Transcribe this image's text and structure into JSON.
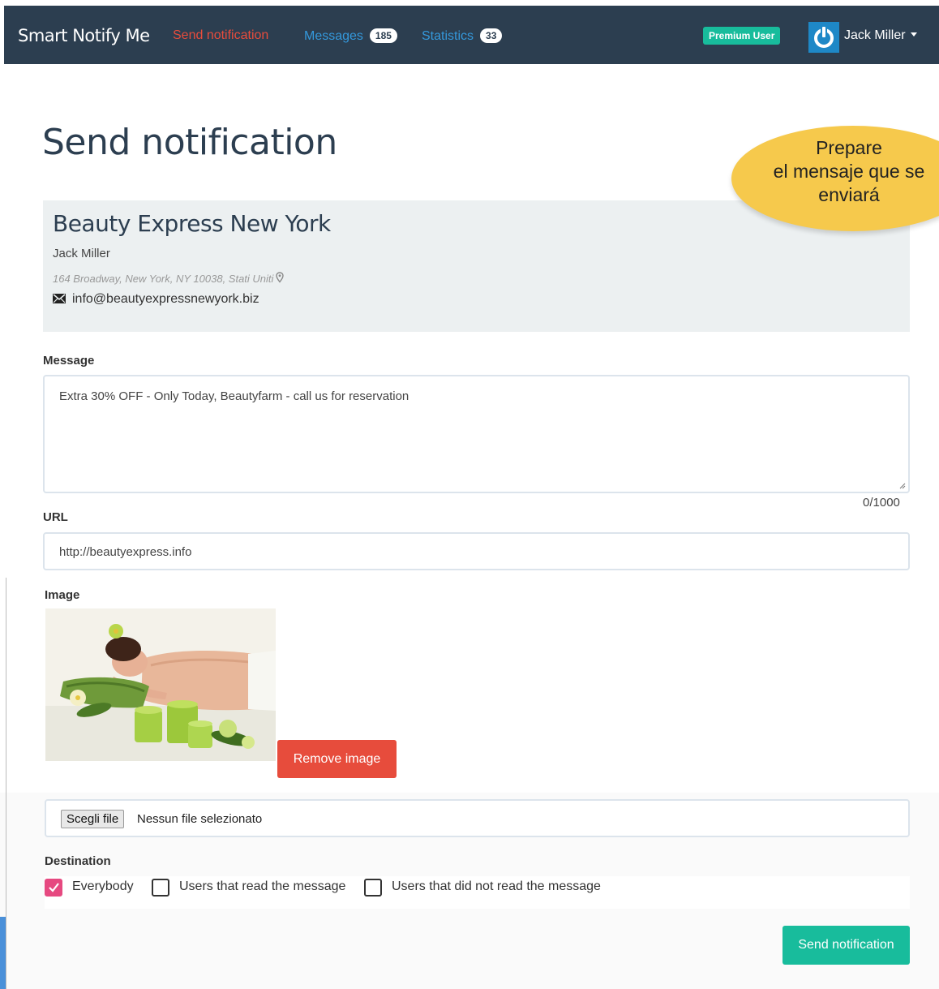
{
  "nav": {
    "brand": "Smart Notify Me",
    "send_label": "Send notification",
    "messages_label": "Messages",
    "messages_count": "185",
    "statistics_label": "Statistics",
    "statistics_count": "33",
    "premium_label": "Premium User",
    "user_name": "Jack Miller"
  },
  "page": {
    "title": "Send notification"
  },
  "callout": {
    "line1": "Prepare",
    "line2": "el mensaje que se",
    "line3": "enviará"
  },
  "business": {
    "name": "Beauty Express New York",
    "owner": "Jack Miller",
    "address": "164 Broadway, New York, NY 10038, Stati Uniti",
    "email": "info@beautyexpressnewyork.biz"
  },
  "form": {
    "message_label": "Message",
    "message_value": "Extra 30% OFF - Only Today, Beautyfarm - call us for reservation",
    "counter": "0/1000",
    "url_label": "URL",
    "url_value": "http://beautyexpress.info",
    "image_label": "Image",
    "remove_image_label": "Remove image",
    "file_button_label": "Scegli file",
    "file_status": "Nessun file selezionato",
    "destination_label": "Destination",
    "destination_options": [
      {
        "label": "Everybody",
        "checked": true
      },
      {
        "label": "Users that read the message",
        "checked": false
      },
      {
        "label": "Users that did not read the message",
        "checked": false
      }
    ],
    "submit_label": "Send notification"
  },
  "colors": {
    "navbar": "#2c3e50",
    "accent_red": "#e74c3c",
    "accent_blue": "#3498db",
    "accent_green": "#18bc9c",
    "checkbox_pink": "#e64980",
    "callout_yellow": "#f6c94c"
  },
  "icons": [
    "power-icon",
    "caret-down-icon",
    "map-pin-icon",
    "envelope-icon",
    "resize-handle-icon",
    "checkmark-icon"
  ]
}
